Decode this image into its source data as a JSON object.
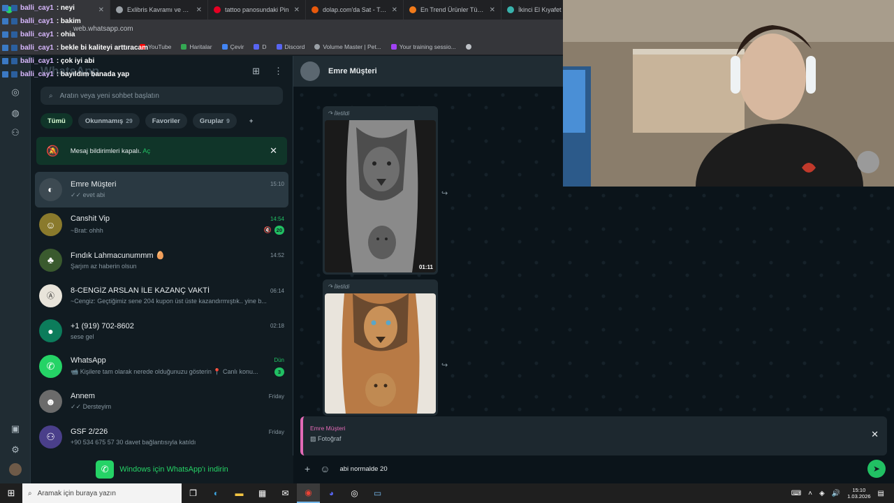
{
  "browser": {
    "tabs": [
      {
        "title": "",
        "active": true,
        "color": "#25d366"
      },
      {
        "title": "Exlibris Kavramı ve Tarihi",
        "color": "#9aa0a6"
      },
      {
        "title": "tattoo panosundaki Pin",
        "color": "#e60023"
      },
      {
        "title": "dolap.com'da Sat - Trendy",
        "color": "#e8590c"
      },
      {
        "title": "En Trend Ürünler Türkiye'",
        "color": "#f27a1a"
      },
      {
        "title": "İkinci El Kıyafet Onl",
        "color": "#38b2ac"
      }
    ],
    "url": "web.whatsapp.com",
    "bookmarks": [
      {
        "label": "YouTube",
        "color": "#ff0000"
      },
      {
        "label": "Haritalar",
        "color": "#34a853"
      },
      {
        "label": "Çevir",
        "color": "#4285f4"
      },
      {
        "label": "D",
        "color": "#5865f2"
      },
      {
        "label": "Discord",
        "color": "#5865f2"
      },
      {
        "label": "Volume Master | Pet...",
        "color": "#9aa0a6"
      },
      {
        "label": "Your training sessio...",
        "color": "#a142f4"
      }
    ]
  },
  "stream_chat": [
    {
      "user": "balli_cay1",
      "msg": ": neyi"
    },
    {
      "user": "balli_cay1",
      "msg": ": bakim"
    },
    {
      "user": "balli_cay1",
      "msg": ": ohia"
    },
    {
      "user": "balli_cay1",
      "msg": ": bekle bi kaliteyi arttıracam"
    },
    {
      "user": "balli_cay1",
      "msg": ": çok iyi abi"
    },
    {
      "user": "balli_cay1",
      "msg": ": bayıldım banada yap"
    }
  ],
  "sidebar": {
    "title": "WhatsApp",
    "search_placeholder": "Aratın veya yeni sohbet başlatın",
    "filters": [
      {
        "label": "Tümü",
        "count": "",
        "active": true
      },
      {
        "label": "Okunmamış",
        "count": "29"
      },
      {
        "label": "Favoriler",
        "count": ""
      },
      {
        "label": "Gruplar",
        "count": "9"
      }
    ],
    "notice": {
      "text": "Mesaj bildirimleri kapalı.",
      "link": "Aç"
    },
    "chats": [
      {
        "name": "Emre Müşteri",
        "time": "15:10",
        "msg": "✓✓ evet abi",
        "selected": true,
        "avatar_color": "#3d4a52"
      },
      {
        "name": "Canshit Vip",
        "time": "14:54",
        "msg": "~Brat: ohhh",
        "unread": "20",
        "muted": true,
        "green_time": true,
        "avatar_color": "#8a7a2c"
      },
      {
        "name": "Fındık Lahmacunummm 🥚",
        "time": "14:52",
        "msg": "Şarjım az haberin olsun",
        "avatar_color": "#3a5a2e"
      },
      {
        "name": "8-CENGİZ ARSLAN İLE KAZANÇ VAKTİ",
        "time": "06:14",
        "msg": "~Cengiz: Geçtiğimiz sene 204 kupon üst üste kazandırmıştık.. yine b...",
        "avatar_color": "#e8e4da"
      },
      {
        "name": "+1 (919) 702-8602",
        "time": "02:18",
        "msg": "sese gel",
        "avatar_color": "#0c7c5b"
      },
      {
        "name": "WhatsApp",
        "time": "Dün",
        "msg": "📹 Kişilere tam olarak nerede olduğunuzu gösterin 📍 Canlı konu...",
        "unread": "3",
        "green_time": true,
        "avatar_color": "#25d366"
      },
      {
        "name": "Annem",
        "time": "Friday",
        "msg": "✓✓ Dersteyim",
        "avatar_color": "#6b6b6b"
      },
      {
        "name": "GSF 2/226",
        "time": "Friday",
        "msg": "+90 534 675 57 30 davet bağlantısıyla katıldı",
        "avatar_color": "#4a3f8a"
      }
    ],
    "download": "Windows için WhatsApp'ı indirin"
  },
  "conversation": {
    "contact": "Emre Müşteri",
    "messages": [
      {
        "forwarded_label": "İletildi",
        "type": "video",
        "duration": "01:11"
      },
      {
        "forwarded_label": "İletildi",
        "type": "image"
      }
    ],
    "reply": {
      "name": "Emre Müşteri",
      "preview": "Fotoğraf"
    },
    "draft": "abi normalde 20"
  },
  "taskbar": {
    "search_placeholder": "Aramak için buraya yazın",
    "time": "15:10",
    "date": "1.03.2026"
  },
  "colors": {
    "accent": "#21c063",
    "panel": "#202c33",
    "bg": "#111b21",
    "reply_accent": "#e26ab6"
  }
}
